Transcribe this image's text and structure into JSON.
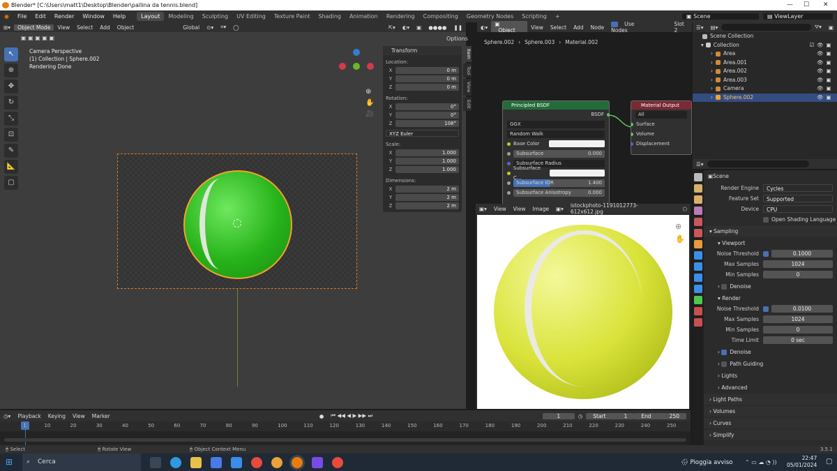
{
  "titlebar": {
    "title": "Blender* [C:\\Users\\matt1\\Desktop\\Blender\\pallina da tennis.blend]"
  },
  "menu": [
    "File",
    "Edit",
    "Render",
    "Window",
    "Help"
  ],
  "workspaces": [
    {
      "label": "Layout",
      "active": true
    },
    {
      "label": "Modeling"
    },
    {
      "label": "Sculpting"
    },
    {
      "label": "UV Editing"
    },
    {
      "label": "Texture Paint"
    },
    {
      "label": "Shading"
    },
    {
      "label": "Animation"
    },
    {
      "label": "Rendering"
    },
    {
      "label": "Compositing"
    },
    {
      "label": "Geometry Nodes"
    },
    {
      "label": "Scripting"
    },
    {
      "label": "+"
    }
  ],
  "scene_selector": "Scene",
  "viewlayer_selector": "ViewLayer",
  "viewport": {
    "mode": "Object Mode",
    "menus": [
      "View",
      "Select",
      "Add",
      "Object"
    ],
    "orientation": "Global",
    "options_label": "Options",
    "overlay_lines": [
      "Camera Perspective",
      "(1) Collection | Sphere.002",
      "Rendering Done"
    ],
    "n_tabs": [
      "Item",
      "Tool",
      "View",
      "Edit"
    ],
    "transform": {
      "title": "Transform",
      "location_label": "Location:",
      "location": [
        {
          "axis": "X",
          "value": "0 m"
        },
        {
          "axis": "Y",
          "value": "0 m"
        },
        {
          "axis": "Z",
          "value": "0 m"
        }
      ],
      "rotation_label": "Rotation:",
      "rotation": [
        {
          "axis": "X",
          "value": "0°"
        },
        {
          "axis": "Y",
          "value": "0°"
        },
        {
          "axis": "Z",
          "value": "108°"
        }
      ],
      "rotation_mode": "XYZ Euler",
      "scale_label": "Scale:",
      "scale": [
        {
          "axis": "X",
          "value": "1.000"
        },
        {
          "axis": "Y",
          "value": "1.000"
        },
        {
          "axis": "Z",
          "value": "1.000"
        }
      ],
      "dimensions_label": "Dimensions:",
      "dimensions": [
        {
          "axis": "X",
          "value": "2 m"
        },
        {
          "axis": "Y",
          "value": "2 m"
        },
        {
          "axis": "Z",
          "value": "2 m"
        }
      ]
    }
  },
  "node_editor": {
    "type": "Object",
    "menus": [
      "View",
      "Select",
      "Add",
      "Node"
    ],
    "use_nodes": "Use Nodes",
    "slot": "Slot 2",
    "breadcrumb": [
      "Sphere.002",
      "Sphere.003",
      "Material.002"
    ],
    "bsdf": {
      "title": "Principled BSDF",
      "output": "BSDF",
      "distribution": "GGX",
      "sss_method": "Random Walk",
      "rows": [
        {
          "label": "Base Color",
          "type": "color"
        },
        {
          "label": "Subsurface",
          "value": "0.000"
        },
        {
          "label": "Subsurface Radius",
          "type": "dd"
        },
        {
          "label": "Subsurface C...",
          "type": "color"
        },
        {
          "label": "Subsurface IOR",
          "value": "1.400"
        },
        {
          "label": "Subsurface Anisotropy",
          "value": "0.000"
        }
      ]
    },
    "output": {
      "title": "Material Output",
      "target": "All",
      "sockets": [
        "Surface",
        "Volume",
        "Displacement"
      ]
    }
  },
  "image_editor": {
    "menus": [
      "View",
      "View",
      "Image"
    ],
    "filename": "istockphoto-1191012773-612x612.jpg"
  },
  "outliner": {
    "root": "Scene Collection",
    "collection": "Collection",
    "items": [
      {
        "name": "Area",
        "color": "#d08a3a"
      },
      {
        "name": "Area.001",
        "color": "#d08a3a"
      },
      {
        "name": "Area.002",
        "color": "#d08a3a"
      },
      {
        "name": "Area.003",
        "color": "#d08a3a"
      },
      {
        "name": "Camera",
        "color": "#d08a3a"
      },
      {
        "name": "Sphere.002",
        "color": "#d08a3a",
        "selected": true
      }
    ]
  },
  "properties": {
    "scene": "Scene",
    "render_engine_label": "Render Engine",
    "render_engine": "Cycles",
    "feature_set_label": "Feature Set",
    "feature_set": "Supported",
    "device_label": "Device",
    "device": "CPU",
    "osl": "Open Shading Language",
    "sampling": "Sampling",
    "viewport": "Viewport",
    "vp_noise_label": "Noise Threshold",
    "vp_noise": "0.1000",
    "vp_max_label": "Max Samples",
    "vp_max": "1024",
    "vp_min_label": "Min Samples",
    "vp_min": "0",
    "denoise": "Denoise",
    "render": "Render",
    "r_noise_label": "Noise Threshold",
    "r_noise": "0.0100",
    "r_max_label": "Max Samples",
    "r_max": "1024",
    "r_min_label": "Min Samples",
    "r_min": "0",
    "time_limit_label": "Time Limit",
    "time_limit": "0 sec",
    "r_denoise": "Denoise",
    "path_guiding": "Path Guiding",
    "lights": "Lights",
    "advanced": "Advanced",
    "light_paths": "Light Paths",
    "volumes": "Volumes",
    "curves": "Curves",
    "simplify": "Simplify"
  },
  "timeline": {
    "menus": [
      "Playback",
      "Keying",
      "View",
      "Marker"
    ],
    "current": "1",
    "start_label": "Start",
    "start": "1",
    "end_label": "End",
    "end": "250",
    "ticks": [
      "1",
      "10",
      "20",
      "30",
      "40",
      "50",
      "60",
      "70",
      "80",
      "90",
      "100",
      "110",
      "120",
      "130",
      "140",
      "150",
      "160",
      "170",
      "180",
      "190",
      "200",
      "210",
      "220",
      "230",
      "240",
      "250"
    ]
  },
  "status": {
    "select": "Select",
    "rotate": "Rotate View",
    "context": "Object Context Menu",
    "version": "3.5.1"
  },
  "taskbar": {
    "search": "Cerca",
    "weather": "Pioggia avviso",
    "time": "22:47",
    "date": "05/01/2024"
  },
  "colors": {
    "accent": "#4772b3",
    "bsdf_header": "#226c3a",
    "output_header": "#7a2a33",
    "selection": "#f7a22c"
  }
}
